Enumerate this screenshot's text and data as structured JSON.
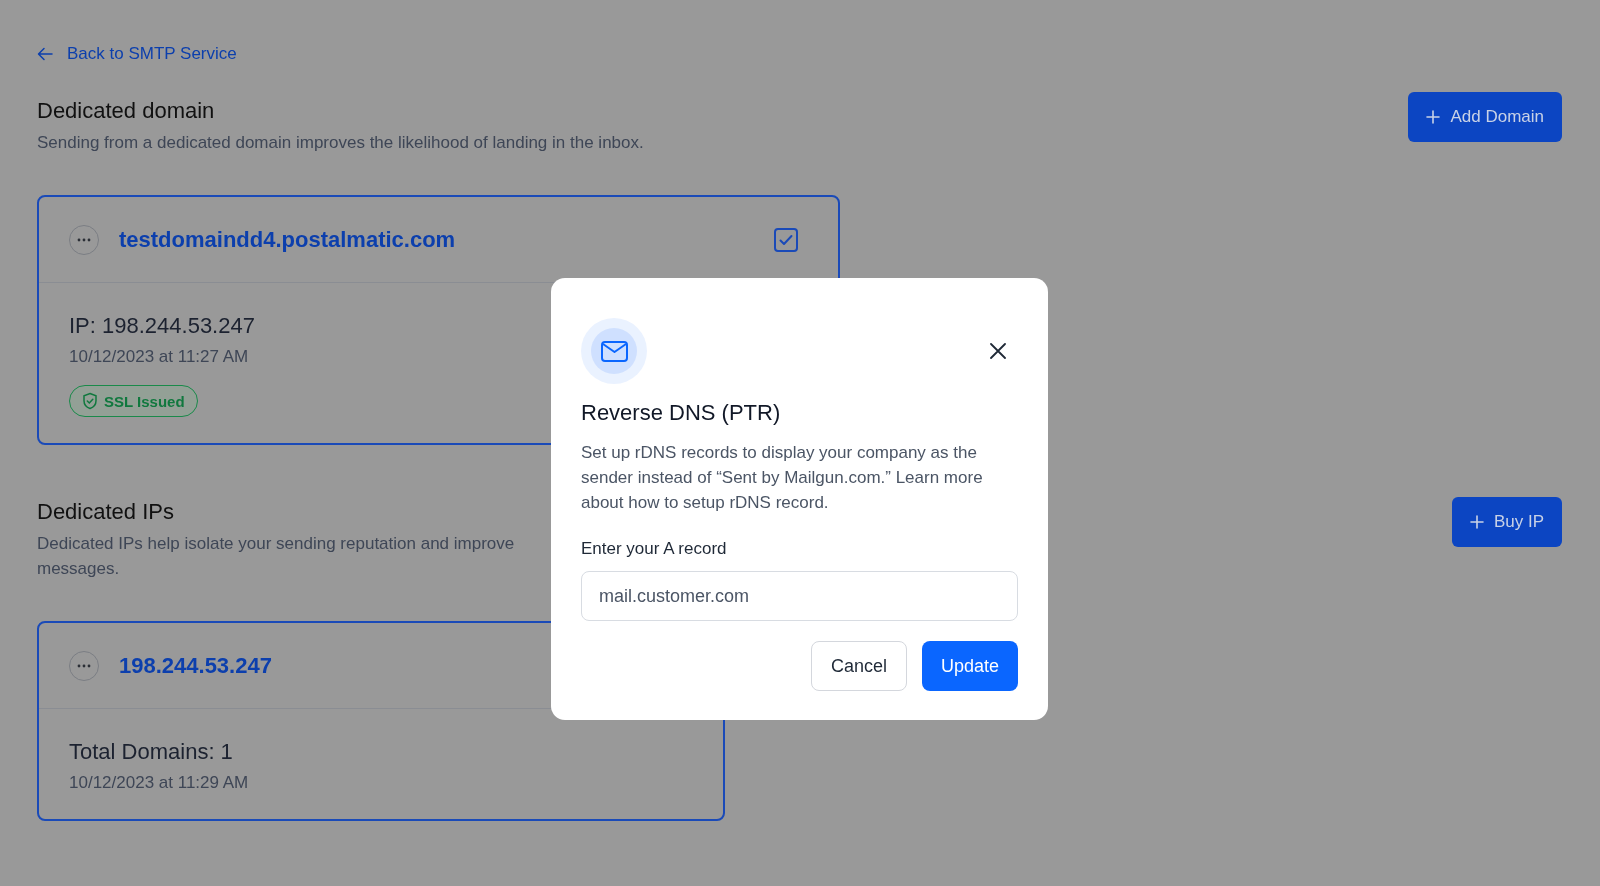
{
  "back_link": {
    "label": "Back to SMTP Service"
  },
  "sections": [
    {
      "title": "Dedicated domain",
      "description_lines": [
        "Sending from a dedicated domain improves the likelihood of landing in the inbox."
      ],
      "action": "Add Domain",
      "card": {
        "kind": "domain",
        "title": "testdomaindd4.postalmatic.com",
        "checked": true,
        "primary": "IP: 198.244.53.247",
        "date": "10/12/2023 at 11:27 AM",
        "badge": "SSL Issued"
      }
    },
    {
      "title": "Dedicated IPs",
      "description_lines": [
        "Dedicated IPs help isolate your sending reputation and improve",
        "messages."
      ],
      "action": "Buy IP",
      "card": {
        "kind": "ip",
        "title": "198.244.53.247",
        "primary": "Total Domains: 1",
        "date": "10/12/2023 at 11:29 AM"
      }
    }
  ],
  "modal": {
    "title": "Reverse DNS (PTR)",
    "description": "Set up rDNS records to display your company as the sender instead of “Sent by Mailgun.com.” Learn more about how to setup rDNS record.",
    "field_label": "Enter your A record",
    "field": {
      "placeholder": "mail.customer.com"
    },
    "buttons": [
      {
        "label": "Cancel",
        "kind": "secondary"
      },
      {
        "label": "Update",
        "kind": "primary"
      }
    ]
  }
}
